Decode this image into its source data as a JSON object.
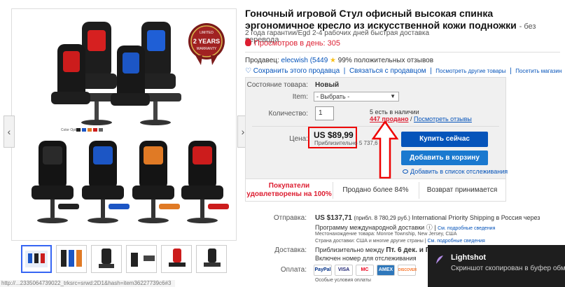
{
  "product": {
    "title": "Гоночный игровой Стул офисный высокая спинка эргономичное кресло из искусственной кожи подножки",
    "title_suffix": "- без перевода",
    "subtitle": "2 года гарантии/Egd 2-4 рабочих дней быстрая доставка",
    "views": "Просмотров в день: 305",
    "badge_line1": "2 YEARS",
    "badge_line2": "WARRANTY",
    "badge_top": "LIMITED"
  },
  "seller": {
    "label": "Продавец:",
    "name": "elecwish",
    "rating": "(5449",
    "feedback": "99% положительных отзывов",
    "save": "Сохранить этого продавца",
    "contact": "Связаться с продавцом",
    "other_items": "Посмотреть другие товары",
    "store": "Посетить магазин"
  },
  "purchase": {
    "condition_label": "Состояние товара:",
    "condition_value": "Новый",
    "item_label": "Item:",
    "item_select": "- Выбрать -",
    "qty_label": "Количество:",
    "qty_value": "1",
    "available": "5 есть в наличии",
    "sold": "447 продано",
    "reviews": "Посмотреть отзывы",
    "price_label": "Цена:",
    "price": "US $89,99",
    "price_approx": "Приблизительно 5 737,6",
    "buy_now": "Купить сейчас",
    "add_to_cart": "Добавить в корзину",
    "watch": "Добавить в список отслеживания"
  },
  "stats": {
    "satisfied": "Покупатели удовлетворены на 100%",
    "sold_over": "Продано более 84%",
    "returns": "Возврат принимается"
  },
  "shipping": {
    "ship_label": "Отправка:",
    "ship_price": "US $137,71",
    "ship_approx": "(прибл. 8 780,29 руб.)",
    "ship_service": "International Priority Shipping в Россия через",
    "ship_program": "Программу международной доставки",
    "details": "См. подробные сведения",
    "location": "Местонахождение товара: Monroe Township, New Jersey, США",
    "ships_to": "Страна доставки: США и многие другие страны",
    "delivery_label": "Доставка:",
    "delivery_text": "Приблизительно между",
    "delivery_date": "Пт. 6 дек. и Пн.16",
    "delivery_note": "Включен номер для отслеживания",
    "payment_label": "Оплата:",
    "payment_note": "Особые условия оплаты"
  },
  "payments": [
    "PayPal",
    "VISA",
    "MC",
    "AMEX",
    "DISCOVER"
  ],
  "gallery": {
    "prev": "‹",
    "next": "›",
    "color_options": "Color Option:"
  },
  "toast": {
    "title": "Lightshot",
    "body": "Скриншот скопирован в буфер обм"
  },
  "status_url": "http://...2335064739022_trksrc=srwd:2D1&hash=item36227739c6#3"
}
